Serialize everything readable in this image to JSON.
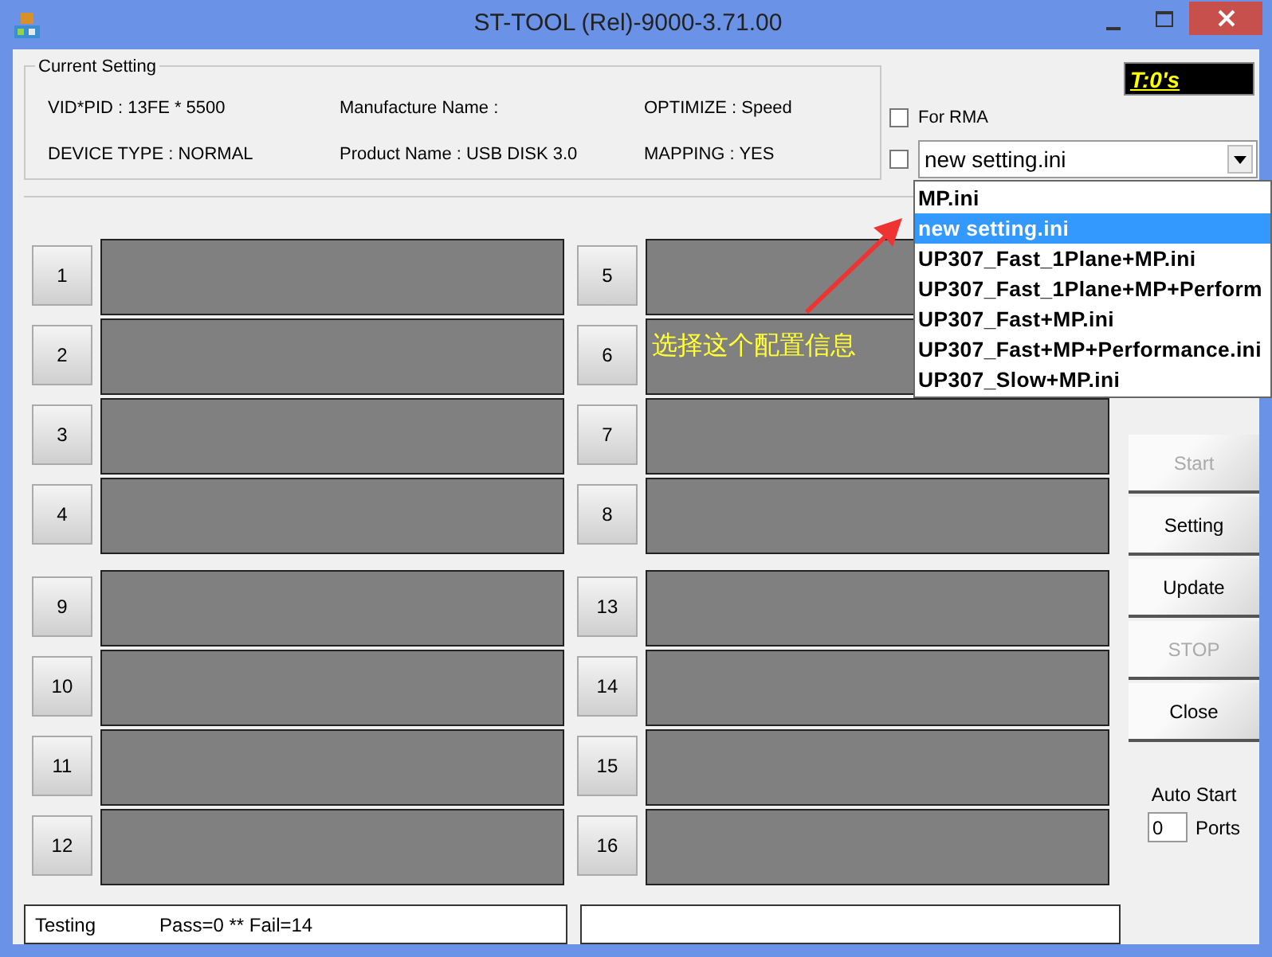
{
  "window": {
    "title": "ST-TOOL (Rel)-9000-3.71.00"
  },
  "current_setting": {
    "title": "Current Setting",
    "fields": [
      "VID*PID : 13FE * 5500",
      "Manufacture Name :",
      "OPTIMIZE : Speed",
      "DEVICE TYPE : NORMAL",
      "Product Name : USB DISK 3.0",
      "MAPPING : YES"
    ]
  },
  "timer": "T:0's",
  "options": [
    {
      "kind": "checkbox",
      "label": "For RMA",
      "checked": false
    },
    {
      "kind": "combo",
      "checked": false,
      "value": "new setting.ini"
    }
  ],
  "dropdown": {
    "items": [
      {
        "label": "MP.ini",
        "selected": false
      },
      {
        "label": "new setting.ini",
        "selected": true
      },
      {
        "label": "UP307_Fast_1Plane+MP.ini",
        "selected": false
      },
      {
        "label": "UP307_Fast_1Plane+MP+Perform",
        "selected": false
      },
      {
        "label": "UP307_Fast+MP.ini",
        "selected": false
      },
      {
        "label": "UP307_Fast+MP+Performance.ini",
        "selected": false
      },
      {
        "label": "UP307_Slow+MP.ini",
        "selected": false
      }
    ]
  },
  "annotation": "选择这个配置信息",
  "ports": [
    "1",
    "5",
    "2",
    "6",
    "3",
    "7",
    "4",
    "8",
    "9",
    "13",
    "10",
    "14",
    "11",
    "15",
    "12",
    "16"
  ],
  "buttons": [
    {
      "label": "Start",
      "disabled": true
    },
    {
      "label": "Setting",
      "disabled": false
    },
    {
      "label": "Update",
      "disabled": false
    },
    {
      "label": "STOP",
      "disabled": true
    },
    {
      "label": "Close",
      "disabled": false
    }
  ],
  "auto_start": {
    "label": "Auto Start",
    "value": "0",
    "unit": "Ports"
  },
  "status": [
    "Testing",
    "Pass=0 ** Fail=14"
  ]
}
